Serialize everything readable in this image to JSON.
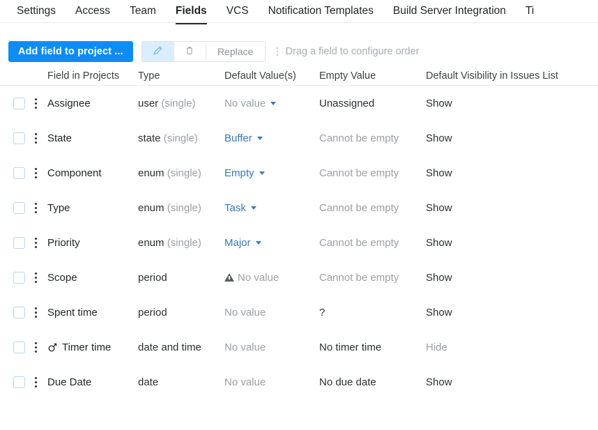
{
  "tabs": [
    {
      "label": "Settings",
      "active": false
    },
    {
      "label": "Access",
      "active": false
    },
    {
      "label": "Team",
      "active": false
    },
    {
      "label": "Fields",
      "active": true
    },
    {
      "label": "VCS",
      "active": false
    },
    {
      "label": "Notification Templates",
      "active": false
    },
    {
      "label": "Build Server Integration",
      "active": false
    },
    {
      "label": "Ti",
      "active": false
    }
  ],
  "toolbar": {
    "add_field_label": "Add field to project ...",
    "edit_icon": "pencil-icon",
    "delete_icon": "trash-icon",
    "replace_label": "Replace",
    "drag_hint": "Drag a field to configure order",
    "accent_color": "#0f8bf5",
    "selected_button_bg": "#dbeeff"
  },
  "table": {
    "headers": {
      "field": "Field in Projects",
      "type": "Type",
      "default": "Default Value(s)",
      "empty": "Empty Value",
      "visibility": "Default Visibility in Issues List"
    },
    "rows": [
      {
        "name": "Assignee",
        "icon": null,
        "type_main": "user",
        "type_sub": "(single)",
        "default": "No value",
        "default_style": "gray",
        "has_caret": true,
        "has_warning": false,
        "empty": "Unassigned",
        "empty_style": "dark",
        "visibility": "Show",
        "visibility_style": "show"
      },
      {
        "name": "State",
        "icon": null,
        "type_main": "state",
        "type_sub": "(single)",
        "default": "Buffer",
        "default_style": "link",
        "has_caret": true,
        "has_warning": false,
        "empty": "Cannot be empty",
        "empty_style": "gray",
        "visibility": "Show",
        "visibility_style": "show"
      },
      {
        "name": "Component",
        "icon": null,
        "type_main": "enum",
        "type_sub": "(single)",
        "default": "Empty",
        "default_style": "link",
        "has_caret": true,
        "has_warning": false,
        "empty": "Cannot be empty",
        "empty_style": "gray",
        "visibility": "Show",
        "visibility_style": "show"
      },
      {
        "name": "Type",
        "icon": null,
        "type_main": "enum",
        "type_sub": "(single)",
        "default": "Task",
        "default_style": "link",
        "has_caret": true,
        "has_warning": false,
        "empty": "Cannot be empty",
        "empty_style": "gray",
        "visibility": "Show",
        "visibility_style": "show"
      },
      {
        "name": "Priority",
        "icon": null,
        "type_main": "enum",
        "type_sub": "(single)",
        "default": "Major",
        "default_style": "link",
        "has_caret": true,
        "has_warning": false,
        "empty": "Cannot be empty",
        "empty_style": "gray",
        "visibility": "Show",
        "visibility_style": "show"
      },
      {
        "name": "Scope",
        "icon": null,
        "type_main": "period",
        "type_sub": "",
        "default": "No value",
        "default_style": "gray",
        "has_caret": false,
        "has_warning": true,
        "empty": "Cannot be empty",
        "empty_style": "gray",
        "visibility": "Show",
        "visibility_style": "show"
      },
      {
        "name": "Spent time",
        "icon": null,
        "type_main": "period",
        "type_sub": "",
        "default": "No value",
        "default_style": "gray",
        "has_caret": false,
        "has_warning": false,
        "empty": "?",
        "empty_style": "dark",
        "visibility": "Show",
        "visibility_style": "show"
      },
      {
        "name": "Timer time",
        "icon": "mars-icon",
        "type_main": "date and time",
        "type_sub": "",
        "default": "No value",
        "default_style": "gray",
        "has_caret": false,
        "has_warning": false,
        "empty": "No timer time",
        "empty_style": "dark",
        "visibility": "Hide",
        "visibility_style": "hide"
      },
      {
        "name": "Due Date",
        "icon": null,
        "type_main": "date",
        "type_sub": "",
        "default": "No value",
        "default_style": "gray",
        "has_caret": false,
        "has_warning": false,
        "empty": "No due date",
        "empty_style": "dark",
        "visibility": "Show",
        "visibility_style": "show"
      }
    ]
  }
}
